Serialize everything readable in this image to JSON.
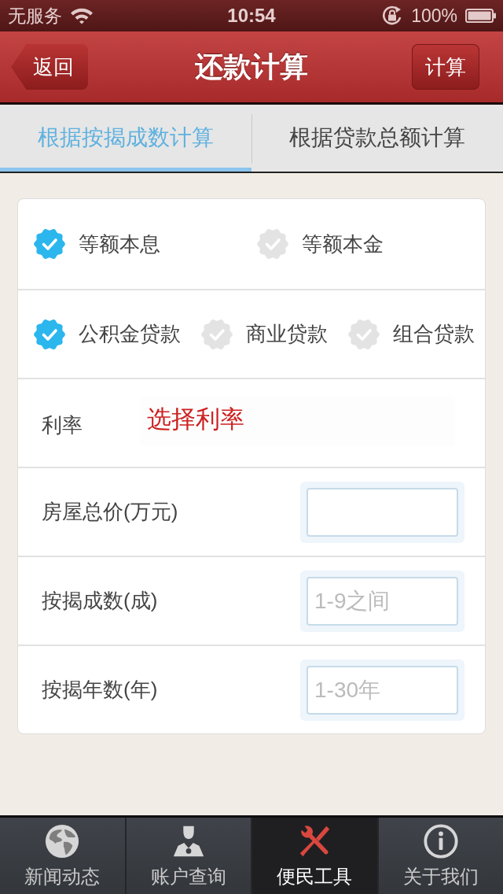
{
  "status_bar": {
    "carrier": "无服务",
    "time": "10:54",
    "battery": "100%"
  },
  "nav_bar": {
    "back_button": "返回",
    "title": "还款计算",
    "action_button": "计算"
  },
  "tabs": [
    {
      "label": "根据按揭成数计算",
      "selected": true
    },
    {
      "label": "根据贷款总额计算",
      "selected": false
    }
  ],
  "form": {
    "repayment_methods": [
      {
        "label": "等额本息",
        "selected": true
      },
      {
        "label": "等额本金",
        "selected": false
      }
    ],
    "loan_types": [
      {
        "label": "公积金贷款",
        "selected": true
      },
      {
        "label": "商业贷款",
        "selected": false
      },
      {
        "label": "组合贷款",
        "selected": false
      }
    ],
    "rate": {
      "label": "利率",
      "value": "选择利率"
    },
    "fields": [
      {
        "label": "房屋总价(万元)"
      },
      {
        "label": "按揭成数(成)",
        "placeholder": "1-9之间"
      },
      {
        "label": "按揭年数(年)",
        "placeholder": "1-30年"
      }
    ]
  },
  "tab_bar": [
    {
      "label": "新闻动态",
      "selected": false
    },
    {
      "label": "账户查询",
      "selected": false
    },
    {
      "label": "便民工具",
      "selected": true
    },
    {
      "label": "关于我们",
      "selected": false
    }
  ]
}
